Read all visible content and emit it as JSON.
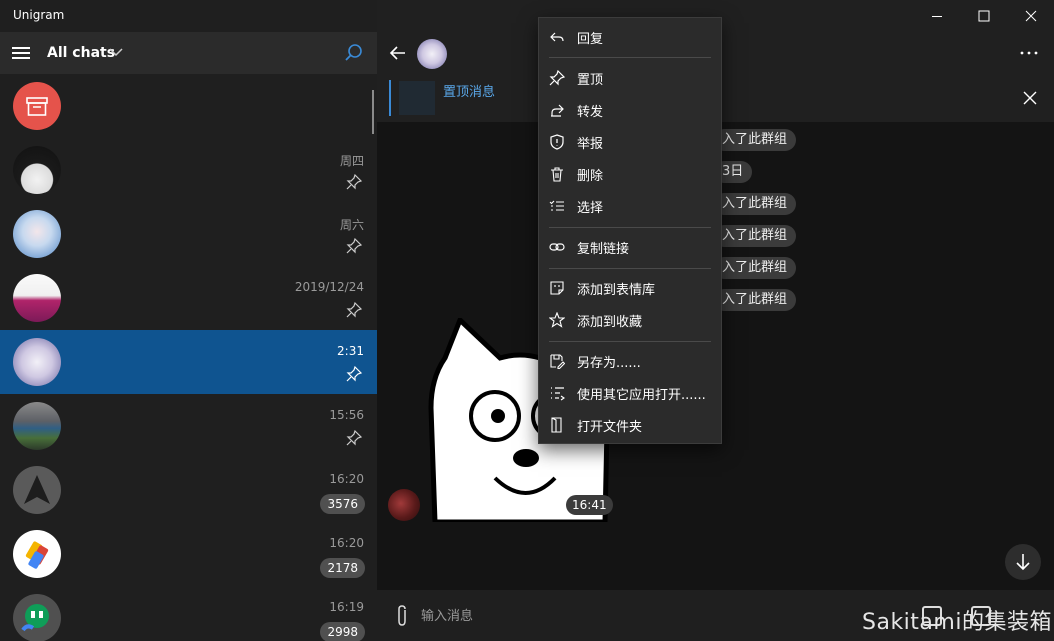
{
  "app": {
    "title": "Unigram"
  },
  "sidebar": {
    "header": {
      "title": "All chats"
    },
    "chats": [
      {
        "time": "",
        "badge": "",
        "pinned": false,
        "selected": false
      },
      {
        "time": "周四",
        "badge": "",
        "pinned": true,
        "selected": false
      },
      {
        "time": "周六",
        "badge": "",
        "pinned": true,
        "selected": false
      },
      {
        "time": "2019/12/24",
        "badge": "",
        "pinned": true,
        "selected": false
      },
      {
        "time": "2:31",
        "badge": "",
        "pinned": true,
        "selected": true
      },
      {
        "time": "15:56",
        "badge": "",
        "pinned": true,
        "selected": false
      },
      {
        "time": "16:20",
        "badge": "3576",
        "pinned": false,
        "selected": false
      },
      {
        "time": "16:20",
        "badge": "2178",
        "pinned": false,
        "selected": false
      },
      {
        "time": "16:19",
        "badge": "2998",
        "pinned": false,
        "selected": false
      }
    ]
  },
  "chat": {
    "pinned": {
      "label": "置顶消息"
    },
    "service_messages": [
      {
        "text": "入了此群组"
      },
      {
        "text": "3日"
      },
      {
        "text": "入了此群组"
      },
      {
        "text": "入了此群组"
      },
      {
        "text": "入了此群组"
      },
      {
        "text": "入了此群组"
      }
    ],
    "message": {
      "time": "16:41"
    },
    "composer": {
      "placeholder": "输入消息"
    },
    "watermark": "Sakitami的集装箱"
  },
  "context_menu": {
    "items": [
      {
        "label": "回复",
        "icon": "reply-icon"
      },
      {
        "label": "置顶",
        "icon": "pin-icon"
      },
      {
        "label": "转发",
        "icon": "forward-icon"
      },
      {
        "label": "举报",
        "icon": "shield-icon"
      },
      {
        "label": "删除",
        "icon": "trash-icon"
      },
      {
        "label": "选择",
        "icon": "select-list-icon"
      },
      {
        "label": "复制链接",
        "icon": "link-icon"
      },
      {
        "label": "添加到表情库",
        "icon": "sticker-add-icon"
      },
      {
        "label": "添加到收藏",
        "icon": "star-icon"
      },
      {
        "label": "另存为......",
        "icon": "save-as-icon"
      },
      {
        "label": "使用其它应用打开......",
        "icon": "open-with-icon"
      },
      {
        "label": "打开文件夹",
        "icon": "folder-icon"
      }
    ]
  },
  "colors": {
    "accent": "#0f5490",
    "link": "#5aa8ea",
    "archive": "#e5534b"
  }
}
